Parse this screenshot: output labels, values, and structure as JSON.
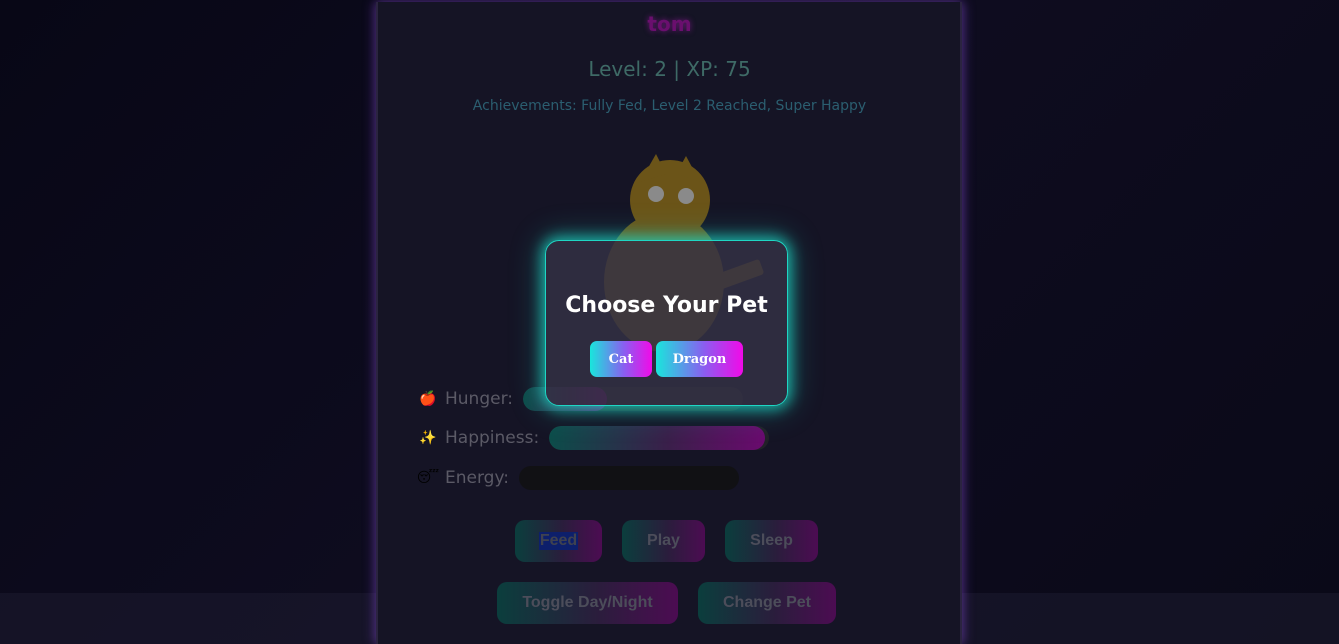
{
  "pet": {
    "name": "tom",
    "level_text": "Level: 2 | XP: 75",
    "achievements_text": "Achievements: Fully Fed, Level 2 Reached, Super Happy"
  },
  "stats": [
    {
      "icon": "apple-icon",
      "glyph": "🍎",
      "label": "Hunger:",
      "value": 0.38
    },
    {
      "icon": "sparkle-icon",
      "glyph": "✨",
      "label": "Happiness:",
      "value": 0.98
    },
    {
      "icon": "sleepy-face-icon",
      "glyph": "😴",
      "label": "Energy:",
      "value": 0.0
    }
  ],
  "actions": {
    "feed": "Feed",
    "play": "Play",
    "sleep": "Sleep",
    "toggle_day_night": "Toggle Day/Night",
    "change_pet": "Change Pet"
  },
  "modal": {
    "title": "Choose Your Pet",
    "options": [
      "Cat",
      "Dragon"
    ]
  },
  "colors": {
    "modal_glow": "#1fd6c4",
    "button_gradient_start": "#19e6dc",
    "button_gradient_end": "#f10ae8",
    "pet_body": "#6b5418"
  }
}
